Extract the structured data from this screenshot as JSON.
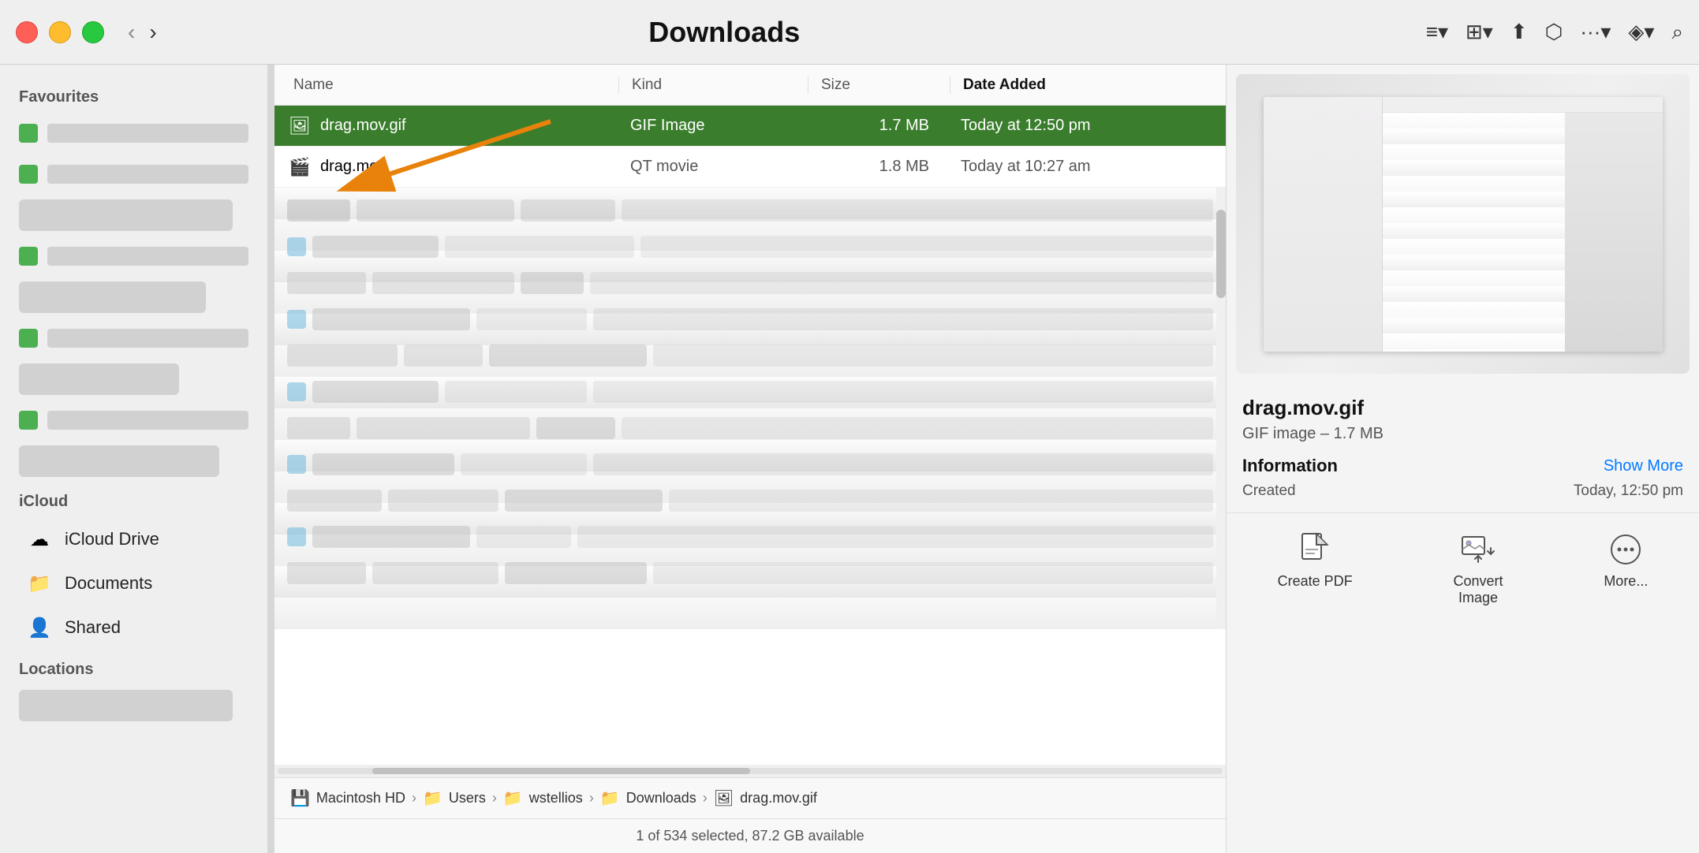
{
  "window": {
    "title": "Downloads",
    "traffic_lights": {
      "red": "close",
      "yellow": "minimize",
      "green": "maximize"
    }
  },
  "toolbar": {
    "back_label": "‹",
    "forward_label": "›",
    "title": "Downloads",
    "list_view_icon": "≡",
    "grid_view_icon": "⊞",
    "share_icon": "⬆",
    "tag_icon": "⬡",
    "more_icon": "···",
    "dropbox_icon": "◈",
    "search_icon": "⌕"
  },
  "sidebar": {
    "sections": [
      {
        "title": "Favourites",
        "items": []
      },
      {
        "title": "iCloud",
        "items": [
          {
            "label": "iCloud Drive",
            "icon": "☁"
          },
          {
            "label": "Documents",
            "icon": "📁"
          },
          {
            "label": "Shared",
            "icon": "👤"
          }
        ]
      },
      {
        "title": "Locations",
        "items": []
      }
    ]
  },
  "file_list": {
    "columns": {
      "name": "Name",
      "kind": "Kind",
      "size": "Size",
      "date_added": "Date Added"
    },
    "files": [
      {
        "name": "drag.mov.gif",
        "kind": "GIF Image",
        "size": "1.7 MB",
        "date": "Today at 12:50 pm",
        "icon": "🖼",
        "selected": true
      },
      {
        "name": "drag.mov",
        "kind": "QT movie",
        "size": "1.8 MB",
        "date": "Today at 10:27 am",
        "icon": "🎬",
        "selected": false
      }
    ]
  },
  "path_bar": {
    "items": [
      {
        "label": "Macintosh HD",
        "icon": "💾"
      },
      {
        "label": "Users",
        "icon": "📁"
      },
      {
        "label": "wstellios",
        "icon": "📁"
      },
      {
        "label": "Downloads",
        "icon": "📁"
      },
      {
        "label": "drag.mov.gif",
        "icon": "🖼"
      }
    ]
  },
  "status_bar": {
    "text": "1 of 534 selected, 87.2 GB available"
  },
  "preview": {
    "filename": "drag.mov.gif",
    "meta": "GIF image – 1.7 MB",
    "info_title": "Information",
    "show_more_label": "Show More",
    "created_label": "Created",
    "created_value": "Today, 12:50 pm",
    "actions": [
      {
        "label": "Create PDF",
        "icon": "📄"
      },
      {
        "label": "Convert Image",
        "icon": "🖼"
      },
      {
        "label": "More...",
        "icon": "···"
      }
    ]
  }
}
